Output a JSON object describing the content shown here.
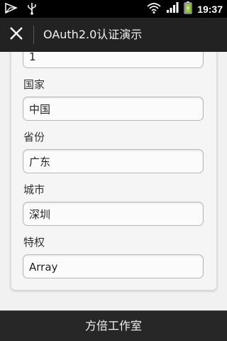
{
  "status_bar": {
    "time": "19:37",
    "icons": [
      "notification-icon",
      "usb-icon",
      "wifi-icon",
      "signal-icon",
      "battery-charging-icon"
    ]
  },
  "action_bar": {
    "close_icon": "close-icon",
    "title": "OAuth2.0认证演示"
  },
  "form": {
    "fields": [
      {
        "label": "",
        "value": "1"
      },
      {
        "label": "国家",
        "value": "中国"
      },
      {
        "label": "省份",
        "value": "广东"
      },
      {
        "label": "城市",
        "value": "深圳"
      },
      {
        "label": "特权",
        "value": "Array"
      }
    ]
  },
  "footer": {
    "text": "方倍工作室"
  },
  "colors": {
    "status_bar_bg": "#000000",
    "action_bar_bg": "#222222",
    "content_bg": "#f1f1f1",
    "footer_bg": "#272727",
    "battery_green": "#8fc73e"
  }
}
